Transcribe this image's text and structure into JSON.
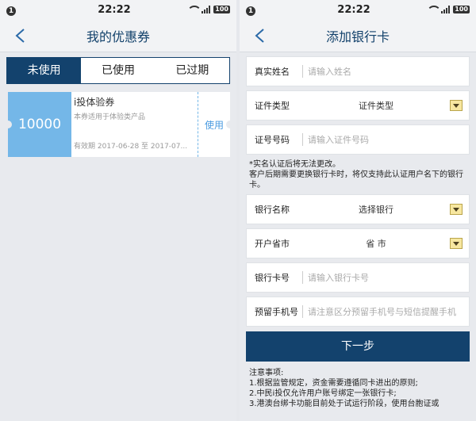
{
  "status": {
    "time": "22:22",
    "notif": "1",
    "battery": "100"
  },
  "left": {
    "title": "我的优惠券",
    "tabs": [
      "未使用",
      "已使用",
      "已过期"
    ],
    "coupon": {
      "amount": "10000",
      "title": "i投体验券",
      "desc": "本券适用于体验类产品",
      "valid": "有效期  2017-06-28 至 2017-07...",
      "use": "使用"
    }
  },
  "right": {
    "title": "添加银行卡",
    "fields": {
      "name_label": "真实姓名",
      "name_placeholder": "请输入姓名",
      "idtype_label": "证件类型",
      "idtype_value": "证件类型",
      "idno_label": "证号号码",
      "idno_placeholder": "请输入证件号码",
      "bank_label": "银行名称",
      "bank_value": "选择银行",
      "city_label": "开户省市",
      "city_value": "省 市",
      "card_label": "银行卡号",
      "card_placeholder": "请输入银行卡号",
      "phone_label": "预留手机号",
      "phone_placeholder": "请注意区分预留手机号与短信提醒手机"
    },
    "note1": "*实名认证后将无法更改。",
    "note2": "客户后期需要更换银行卡时，将仅支持此认证用户名下的银行卡。",
    "submit": "下一步",
    "notes_title": "注意事项:",
    "notes": [
      "1.根据监管规定，资金需要遵循同卡进出的原则;",
      "2.中民i投仅允许用户账号绑定一张银行卡;",
      "3.港澳台绑卡功能目前处于试运行阶段，使用台胞证或"
    ]
  }
}
